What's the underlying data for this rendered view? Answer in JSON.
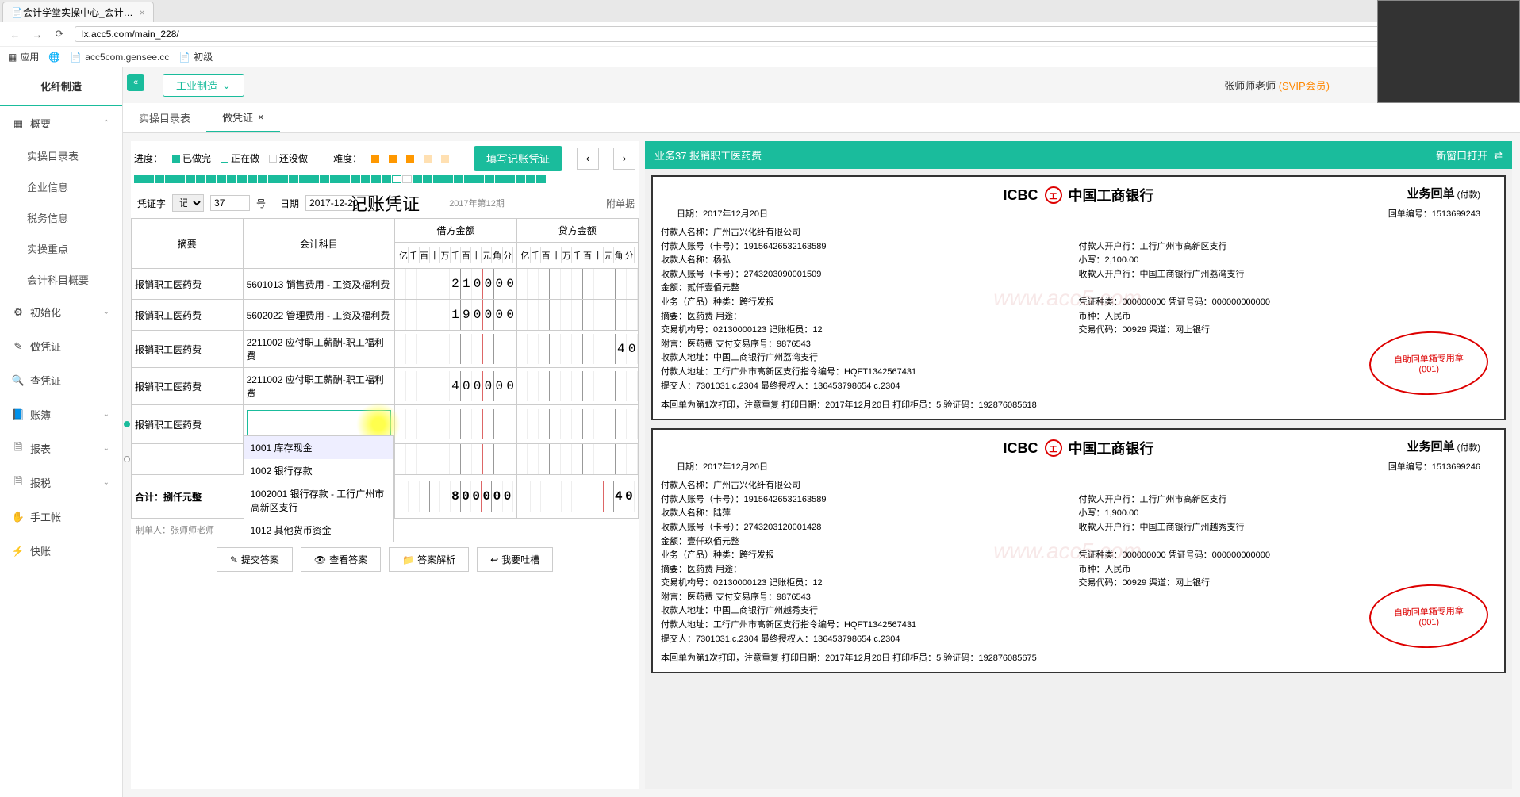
{
  "browser": {
    "tab_title": "会计学堂实操中心_会计…",
    "url": "lx.acc5.com/main_228/",
    "bookmarks": {
      "apps": "应用",
      "gensee": "acc5com.gensee.cc",
      "chuji": "初级"
    }
  },
  "user": {
    "name": "张师师老师",
    "svip": "(SVIP会员)"
  },
  "sidebar": {
    "title": "化纤制造",
    "items": {
      "gaiyao": "概要",
      "shicao_mulu": "实操目录表",
      "qiye_xinxi": "企业信息",
      "shuiwu_xinxi": "税务信息",
      "shicao_zhongdian": "实操重点",
      "kemu_gaiyao": "会计科目概要",
      "chushihua": "初始化",
      "zuopingzheng": "做凭证",
      "chapingzheng": "查凭证",
      "zhangbu": "账簿",
      "baobiao": "报表",
      "baoshui": "报税",
      "shougongzhang": "手工帐",
      "kuaizhang": "快账"
    }
  },
  "top_dropdown": "工业制造",
  "tabs": {
    "t1": "实操目录表",
    "t2": "做凭证"
  },
  "progress": {
    "label": "进度：",
    "done": "已做完",
    "doing": "正在做",
    "todo": "还没做",
    "diff_label": "难度：",
    "fill_btn": "填写记账凭证"
  },
  "voucher": {
    "pz_label": "凭证字",
    "pz_type": "记",
    "pz_num": "37",
    "hao": "号",
    "date_label": "日期",
    "date": "2017-12-20",
    "title": "记账凭证",
    "period": "2017年第12期",
    "attach": "附单据",
    "cols": {
      "summary": "摘要",
      "subject": "会计科目",
      "debit": "借方金额",
      "credit": "贷方金额"
    },
    "digits": [
      "亿",
      "千",
      "百",
      "十",
      "万",
      "千",
      "百",
      "十",
      "元",
      "角",
      "分"
    ],
    "rows": [
      {
        "summary": "报销职工医药费",
        "subject": "5601013 销售费用 - 工资及福利费",
        "debit": "210000",
        "credit": ""
      },
      {
        "summary": "报销职工医药费",
        "subject": "5602022 管理费用 - 工资及福利费",
        "debit": "190000",
        "credit": ""
      },
      {
        "summary": "报销职工医药费",
        "subject": "2211002 应付职工薪酬-职工福利费",
        "debit": "",
        "credit": "40"
      },
      {
        "summary": "报销职工医药费",
        "subject": "2211002 应付职工薪酬-职工福利费",
        "debit": "400000",
        "credit": ""
      },
      {
        "summary": "报销职工医药费",
        "subject": "",
        "debit": "",
        "credit": ""
      }
    ],
    "dropdown": [
      "1001 库存现金",
      "1002 银行存款",
      "1002001 银行存款 - 工行广州市高新区支行",
      "1012 其他货币资金"
    ],
    "total_label": "合计：捌仟元整",
    "total_debit": "800000",
    "total_credit": "40",
    "maker_label": "制单人：",
    "maker": "张师师老师",
    "btns": {
      "submit": "提交答案",
      "view": "查看答案",
      "explain": "答案解析",
      "feedback": "我要吐槽"
    }
  },
  "receipt_panel": {
    "title": "业务37 报销职工医药费",
    "open_new": "新窗口打开"
  },
  "receipts": [
    {
      "bank": "中国工商银行",
      "type_title": "业务回单",
      "type_sub": "(付款)",
      "date": "日期：2017年12月20日",
      "hd_no": "回单编号：1513699243",
      "lines": [
        {
          "l": "付款人名称：广州古兴化纤有限公司",
          "r": ""
        },
        {
          "l": "付款人账号（卡号）：19156426532163589",
          "r": "付款人开户行：工行广州市高新区支行"
        },
        {
          "l": "收款人名称：杨弘",
          "r": "小写：2,100.00"
        },
        {
          "l": "收款人账号（卡号）：2743203090001509",
          "r": "收款人开户行：中国工商银行广州荔湾支行"
        },
        {
          "l": "金额：贰仟壹佰元整",
          "r": ""
        },
        {
          "l": "业务（产品）种类：跨行发报",
          "r": "凭证种类：000000000  凭证号码：000000000000"
        },
        {
          "l": "摘要：医药费                                用途：",
          "r": "币种：人民币"
        },
        {
          "l": "交易机构号：02130000123     记账柜员：12",
          "r": "交易代码：00929     渠道：网上银行"
        },
        {
          "l": "附言：医药费      支付交易序号：9876543",
          "r": ""
        },
        {
          "l": "收款人地址：中国工商银行广州荔湾支行",
          "r": ""
        },
        {
          "l": "付款人地址：工行广州市高新区支行指令编号：HQFT1342567431",
          "r": ""
        },
        {
          "l": "提交人：7301031.c.2304 最终授权人：136453798654 c.2304",
          "r": ""
        }
      ],
      "footer": "本回单为第1次打印，注意重复  打印日期：2017年12月20日  打印柜员：5  验证码：192876085618",
      "stamp": "自助回单箱专用章\n(001)"
    },
    {
      "bank": "中国工商银行",
      "type_title": "业务回单",
      "type_sub": "(付款)",
      "date": "日期：2017年12月20日",
      "hd_no": "回单编号：1513699246",
      "lines": [
        {
          "l": "付款人名称：广州古兴化纤有限公司",
          "r": ""
        },
        {
          "l": "付款人账号（卡号）：19156426532163589",
          "r": "付款人开户行：工行广州市高新区支行"
        },
        {
          "l": "收款人名称：陆萍",
          "r": "小写：1,900.00"
        },
        {
          "l": "收款人账号（卡号）：2743203120001428",
          "r": "收款人开户行：中国工商银行广州越秀支行"
        },
        {
          "l": "金额：壹仟玖佰元整",
          "r": ""
        },
        {
          "l": "业务（产品）种类：跨行发报",
          "r": "凭证种类：000000000  凭证号码：000000000000"
        },
        {
          "l": "摘要：医药费                                用途：",
          "r": "币种：人民币"
        },
        {
          "l": "交易机构号：02130000123     记账柜员：12",
          "r": "交易代码：00929     渠道：网上银行"
        },
        {
          "l": "附言：医药费      支付交易序号：9876543",
          "r": ""
        },
        {
          "l": "收款人地址：中国工商银行广州越秀支行",
          "r": ""
        },
        {
          "l": "付款人地址：工行广州市高新区支行指令编号：HQFT1342567431",
          "r": ""
        },
        {
          "l": "提交人：7301031.c.2304 最终授权人：136453798654 c.2304",
          "r": ""
        }
      ],
      "footer": "本回单为第1次打印，注意重复  打印日期：2017年12月20日  打印柜员：5  验证码：192876085675",
      "stamp": "自助回单箱专用章\n(001)"
    }
  ]
}
